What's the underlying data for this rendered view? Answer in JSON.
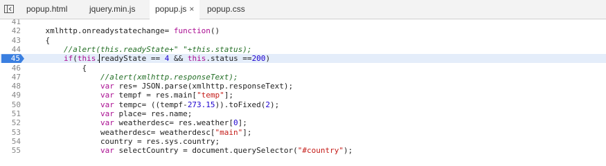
{
  "tabs": [
    {
      "label": "popup.html",
      "active": false
    },
    {
      "label": "jquery.min.js",
      "active": false
    },
    {
      "label": "popup.js",
      "active": true,
      "close": "×"
    },
    {
      "label": "popup.css",
      "active": false
    }
  ],
  "editor": {
    "current_line": 45,
    "lines": [
      {
        "num": "41",
        "tokens": []
      },
      {
        "num": "42",
        "tokens": [
          [
            "p",
            "    xmlhttp.onreadystatechange= "
          ],
          [
            "k",
            "function"
          ],
          [
            "p",
            "()"
          ]
        ]
      },
      {
        "num": "43",
        "tokens": [
          [
            "p",
            "    {"
          ]
        ]
      },
      {
        "num": "44",
        "tokens": [
          [
            "p",
            "        "
          ],
          [
            "c",
            "//alert(this.readyState+\" \"+this.status);"
          ]
        ]
      },
      {
        "num": "45",
        "tokens": [
          [
            "p",
            "        "
          ],
          [
            "k",
            "if"
          ],
          [
            "p",
            "("
          ],
          [
            "k",
            "this"
          ],
          [
            "p",
            ".readyState == "
          ],
          [
            "n",
            "4"
          ],
          [
            "p",
            " && "
          ],
          [
            "k",
            "this"
          ],
          [
            "p",
            ".status =="
          ],
          [
            "n",
            "200"
          ],
          [
            "p",
            ")"
          ]
        ]
      },
      {
        "num": "46",
        "tokens": [
          [
            "p",
            "            {"
          ]
        ]
      },
      {
        "num": "47",
        "tokens": [
          [
            "p",
            "                "
          ],
          [
            "c",
            "//alert(xmlhttp.responseText);"
          ]
        ]
      },
      {
        "num": "48",
        "tokens": [
          [
            "p",
            "                "
          ],
          [
            "k",
            "var"
          ],
          [
            "p",
            " res= JSON.parse(xmlhttp.responseText);"
          ]
        ]
      },
      {
        "num": "49",
        "tokens": [
          [
            "p",
            "                "
          ],
          [
            "k",
            "var"
          ],
          [
            "p",
            " tempf = res.main["
          ],
          [
            "s",
            "\"temp\""
          ],
          [
            "p",
            "];"
          ]
        ]
      },
      {
        "num": "50",
        "tokens": [
          [
            "p",
            "                "
          ],
          [
            "k",
            "var"
          ],
          [
            "p",
            " tempc= ((tempf-"
          ],
          [
            "n",
            "273.15"
          ],
          [
            "p",
            ")).toFixed("
          ],
          [
            "n",
            "2"
          ],
          [
            "p",
            ");"
          ]
        ]
      },
      {
        "num": "51",
        "tokens": [
          [
            "p",
            "                "
          ],
          [
            "k",
            "var"
          ],
          [
            "p",
            " place= res.name;"
          ]
        ]
      },
      {
        "num": "52",
        "tokens": [
          [
            "p",
            "                "
          ],
          [
            "k",
            "var"
          ],
          [
            "p",
            " weatherdesc= res.weather["
          ],
          [
            "n",
            "0"
          ],
          [
            "p",
            "];"
          ]
        ]
      },
      {
        "num": "53",
        "tokens": [
          [
            "p",
            "                weatherdesc= weatherdesc["
          ],
          [
            "s",
            "\"main\""
          ],
          [
            "p",
            "];"
          ]
        ]
      },
      {
        "num": "54",
        "tokens": [
          [
            "p",
            "                country = res.sys.country;"
          ]
        ]
      },
      {
        "num": "55",
        "tokens": [
          [
            "p",
            "                "
          ],
          [
            "k",
            "var"
          ],
          [
            "p",
            " selectCountry = document.querySelector("
          ],
          [
            "s",
            "\"#country\""
          ],
          [
            "p",
            ");"
          ]
        ]
      }
    ]
  },
  "icons": {
    "navigator_toggle": "sidebar-toggle-icon",
    "tab_close": "close-icon"
  },
  "colors": {
    "keyword": "#aa0d91",
    "number": "#1c00cf",
    "string": "#c41a16",
    "comment": "#236e25",
    "line_highlight": "#e4edfa",
    "breakpoint_marker": "#3a7fe0"
  }
}
